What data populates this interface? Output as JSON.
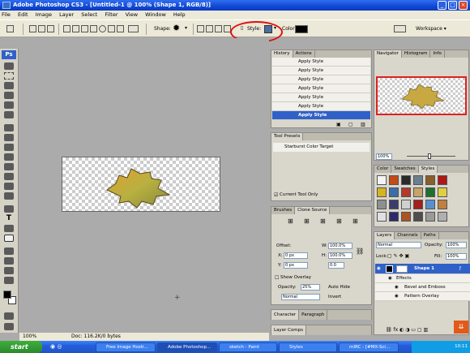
{
  "window": {
    "title": "Adobe Photoshop CS3 - [Untitled-1 @ 100% (Shape 1, RGB/8)]"
  },
  "menu": [
    "File",
    "Edit",
    "Image",
    "Layer",
    "Select",
    "Filter",
    "View",
    "Window",
    "Help"
  ],
  "options_bar": {
    "shape_label": "Shape:",
    "style_label": "Style:",
    "color_label": "Color:",
    "color_value": "#000000",
    "workspace_label": "Workspace ▾",
    "highlight_color": "#e01010"
  },
  "toolbox": {
    "logo": "Ps"
  },
  "history_panel": {
    "tabs": [
      "History",
      "Actions"
    ],
    "rows": [
      "Apply Style",
      "Apply Style",
      "Apply Style",
      "Apply Style",
      "Apply Style",
      "Apply Style",
      "Apply Style"
    ],
    "selected_row": "Apply Style"
  },
  "navigator_panel": {
    "tabs": [
      "Navigator",
      "Histogram",
      "Info"
    ],
    "zoom": "100%"
  },
  "tool_presets_panel": {
    "tabs": [
      "Tool Presets"
    ],
    "preset": "Starburst Color Target",
    "current_tool_only": "Current Tool Only"
  },
  "styles_panel": {
    "tabs": [
      "Color",
      "Swatches",
      "Styles"
    ],
    "swatches": [
      "#f4f4f4",
      "#c44a16",
      "#2a2a2a",
      "#6d7f8e",
      "#8a5f2a",
      "#b01818",
      "#d6b420",
      "#3a6ea8",
      "#b23a2a",
      "#c8a36a",
      "#1f6f2e",
      "#e0d040",
      "#8f8f8f",
      "#3d3d6b",
      "#d0d0d0",
      "#a31e1e",
      "#5a8fcf",
      "#c08040",
      "#e0e0e0",
      "#2b2b6a",
      "#aa5522",
      "#4e4e4e",
      "#9a9a9a",
      "#b0b0b0"
    ]
  },
  "brushes_panel": {
    "tabs": [
      "Brushes",
      "Clone Source"
    ],
    "offset_label": "Offset:",
    "x_label": "X:",
    "x_value": "0 px",
    "y_label": "Y:",
    "y_value": "0 px",
    "w_label": "W:",
    "w_value": "100.0%",
    "h_label": "H:",
    "h_value": "100.0%",
    "angle_value": "0.0",
    "show_overlay": "Show Overlay",
    "opacity_label": "Opacity:",
    "opacity_value": "25%",
    "auto_hide": "Auto Hide",
    "blend_mode": "Normal",
    "invert": "Invert"
  },
  "character_panel": {
    "tabs": [
      "Character",
      "Paragraph"
    ]
  },
  "layer_comps_panel": {
    "tabs": [
      "Layer Comps"
    ]
  },
  "layers_panel": {
    "tabs": [
      "Layers",
      "Channels",
      "Paths"
    ],
    "blend_mode": "Normal",
    "opacity_label": "Opacity:",
    "opacity_value": "100%",
    "lock_label": "Lock:",
    "fill_label": "Fill:",
    "fill_value": "100%",
    "layer_name": "Shape 1",
    "effects": "Effects",
    "effect_items": [
      "Bevel and Emboss",
      "Pattern Overlay"
    ]
  },
  "status_bar": {
    "zoom": "100%",
    "doc": "Doc: 116.2K/0 bytes"
  },
  "taskbar": {
    "start": "start",
    "tasks": [
      "Free Image Hosti...",
      "Adobe Photoshop...",
      "sketch - Paint",
      "Styles",
      "mIRC - [#MX-Sci..."
    ],
    "clock": "10:11"
  }
}
